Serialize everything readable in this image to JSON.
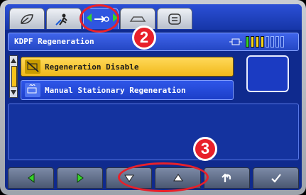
{
  "tabs": [
    {
      "icon": "leaf-icon"
    },
    {
      "icon": "operator-icon"
    },
    {
      "icon": "wrench-icon",
      "active": true
    },
    {
      "icon": "truck-icon"
    },
    {
      "icon": "menu-icon"
    }
  ],
  "header": {
    "title": "KDPF Regeneration",
    "level_icon": "dpf-level-icon",
    "level_filled": 4,
    "level_total": 8
  },
  "list": {
    "items": [
      {
        "label": "Regeneration Disable",
        "icon": "regeneration-disable-icon",
        "selected": true
      },
      {
        "label": "Manual Stationary Regeneration",
        "icon": "manual-regeneration-icon",
        "selected": false
      }
    ]
  },
  "soft_buttons": [
    {
      "icon": "left-arrow-icon"
    },
    {
      "icon": "right-arrow-icon"
    },
    {
      "icon": "down-arrow-icon"
    },
    {
      "icon": "up-arrow-icon"
    },
    {
      "icon": "return-icon"
    },
    {
      "icon": "check-icon"
    }
  ],
  "callouts": {
    "tab_badge": "2",
    "buttons_badge": "3"
  },
  "colors": {
    "selected_item": "#f1b91a",
    "screen_bg": "#0f2a8e",
    "annotation": "#e8202a",
    "level_fill": "#f5d51b",
    "level_active": "#37d42a"
  }
}
